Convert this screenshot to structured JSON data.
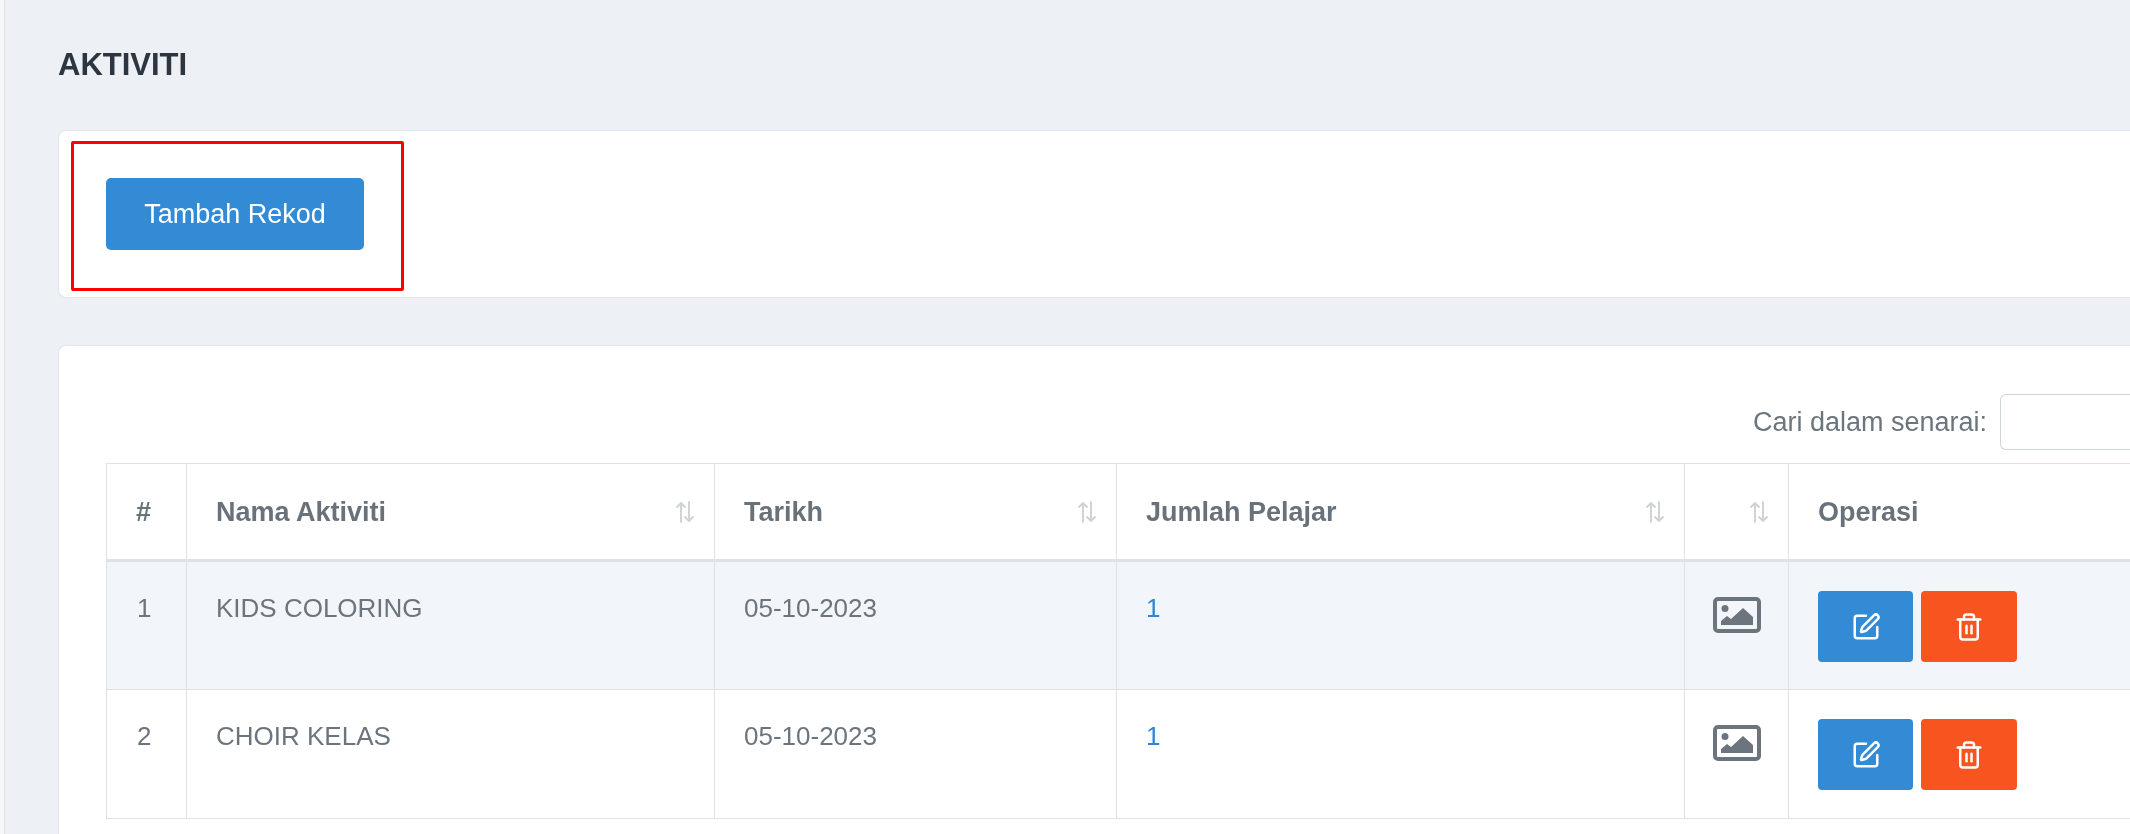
{
  "page": {
    "title": "AKTIVITI"
  },
  "toolbar": {
    "add_button": {
      "label": "Tambah Rekod",
      "highlighted": true
    }
  },
  "table": {
    "search": {
      "label": "Cari dalam senarai:"
    },
    "columns": [
      {
        "label": "#",
        "sortable": false
      },
      {
        "label": "Nama Aktiviti",
        "sortable": true
      },
      {
        "label": "Tarikh",
        "sortable": true
      },
      {
        "label": "Jumlah Pelajar",
        "sortable": true
      },
      {
        "sortable": true
      },
      {
        "label": "Operasi",
        "sortable": false
      }
    ],
    "rows": [
      {
        "number": "1",
        "name": "KIDS COLORING",
        "date": "05-10-2023",
        "students": "1",
        "has_image": true,
        "actions": [
          {
            "kind": "edit"
          },
          {
            "kind": "delete"
          }
        ]
      },
      {
        "number": "2",
        "name": "CHOIR KELAS",
        "date": "05-10-2023",
        "students": "1",
        "has_image": true,
        "actions": [
          {
            "kind": "edit"
          },
          {
            "kind": "delete"
          }
        ]
      }
    ]
  }
}
